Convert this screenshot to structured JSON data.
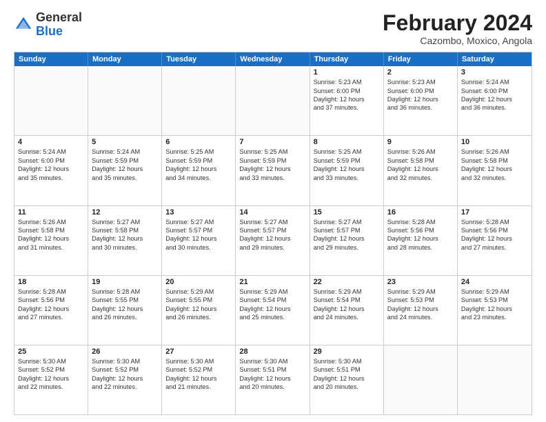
{
  "header": {
    "logo_general": "General",
    "logo_blue": "Blue",
    "title": "February 2024",
    "subtitle": "Cazombo, Moxico, Angola"
  },
  "calendar": {
    "days_of_week": [
      "Sunday",
      "Monday",
      "Tuesday",
      "Wednesday",
      "Thursday",
      "Friday",
      "Saturday"
    ],
    "rows": [
      [
        {
          "day": "",
          "empty": true
        },
        {
          "day": "",
          "empty": true
        },
        {
          "day": "",
          "empty": true
        },
        {
          "day": "",
          "empty": true
        },
        {
          "day": "1",
          "lines": [
            "Sunrise: 5:23 AM",
            "Sunset: 6:00 PM",
            "Daylight: 12 hours",
            "and 37 minutes."
          ]
        },
        {
          "day": "2",
          "lines": [
            "Sunrise: 5:23 AM",
            "Sunset: 6:00 PM",
            "Daylight: 12 hours",
            "and 36 minutes."
          ]
        },
        {
          "day": "3",
          "lines": [
            "Sunrise: 5:24 AM",
            "Sunset: 6:00 PM",
            "Daylight: 12 hours",
            "and 36 minutes."
          ]
        }
      ],
      [
        {
          "day": "4",
          "lines": [
            "Sunrise: 5:24 AM",
            "Sunset: 6:00 PM",
            "Daylight: 12 hours",
            "and 35 minutes."
          ]
        },
        {
          "day": "5",
          "lines": [
            "Sunrise: 5:24 AM",
            "Sunset: 5:59 PM",
            "Daylight: 12 hours",
            "and 35 minutes."
          ]
        },
        {
          "day": "6",
          "lines": [
            "Sunrise: 5:25 AM",
            "Sunset: 5:59 PM",
            "Daylight: 12 hours",
            "and 34 minutes."
          ]
        },
        {
          "day": "7",
          "lines": [
            "Sunrise: 5:25 AM",
            "Sunset: 5:59 PM",
            "Daylight: 12 hours",
            "and 33 minutes."
          ]
        },
        {
          "day": "8",
          "lines": [
            "Sunrise: 5:25 AM",
            "Sunset: 5:59 PM",
            "Daylight: 12 hours",
            "and 33 minutes."
          ]
        },
        {
          "day": "9",
          "lines": [
            "Sunrise: 5:26 AM",
            "Sunset: 5:58 PM",
            "Daylight: 12 hours",
            "and 32 minutes."
          ]
        },
        {
          "day": "10",
          "lines": [
            "Sunrise: 5:26 AM",
            "Sunset: 5:58 PM",
            "Daylight: 12 hours",
            "and 32 minutes."
          ]
        }
      ],
      [
        {
          "day": "11",
          "lines": [
            "Sunrise: 5:26 AM",
            "Sunset: 5:58 PM",
            "Daylight: 12 hours",
            "and 31 minutes."
          ]
        },
        {
          "day": "12",
          "lines": [
            "Sunrise: 5:27 AM",
            "Sunset: 5:58 PM",
            "Daylight: 12 hours",
            "and 30 minutes."
          ]
        },
        {
          "day": "13",
          "lines": [
            "Sunrise: 5:27 AM",
            "Sunset: 5:57 PM",
            "Daylight: 12 hours",
            "and 30 minutes."
          ]
        },
        {
          "day": "14",
          "lines": [
            "Sunrise: 5:27 AM",
            "Sunset: 5:57 PM",
            "Daylight: 12 hours",
            "and 29 minutes."
          ]
        },
        {
          "day": "15",
          "lines": [
            "Sunrise: 5:27 AM",
            "Sunset: 5:57 PM",
            "Daylight: 12 hours",
            "and 29 minutes."
          ]
        },
        {
          "day": "16",
          "lines": [
            "Sunrise: 5:28 AM",
            "Sunset: 5:56 PM",
            "Daylight: 12 hours",
            "and 28 minutes."
          ]
        },
        {
          "day": "17",
          "lines": [
            "Sunrise: 5:28 AM",
            "Sunset: 5:56 PM",
            "Daylight: 12 hours",
            "and 27 minutes."
          ]
        }
      ],
      [
        {
          "day": "18",
          "lines": [
            "Sunrise: 5:28 AM",
            "Sunset: 5:56 PM",
            "Daylight: 12 hours",
            "and 27 minutes."
          ]
        },
        {
          "day": "19",
          "lines": [
            "Sunrise: 5:28 AM",
            "Sunset: 5:55 PM",
            "Daylight: 12 hours",
            "and 26 minutes."
          ]
        },
        {
          "day": "20",
          "lines": [
            "Sunrise: 5:29 AM",
            "Sunset: 5:55 PM",
            "Daylight: 12 hours",
            "and 26 minutes."
          ]
        },
        {
          "day": "21",
          "lines": [
            "Sunrise: 5:29 AM",
            "Sunset: 5:54 PM",
            "Daylight: 12 hours",
            "and 25 minutes."
          ]
        },
        {
          "day": "22",
          "lines": [
            "Sunrise: 5:29 AM",
            "Sunset: 5:54 PM",
            "Daylight: 12 hours",
            "and 24 minutes."
          ]
        },
        {
          "day": "23",
          "lines": [
            "Sunrise: 5:29 AM",
            "Sunset: 5:53 PM",
            "Daylight: 12 hours",
            "and 24 minutes."
          ]
        },
        {
          "day": "24",
          "lines": [
            "Sunrise: 5:29 AM",
            "Sunset: 5:53 PM",
            "Daylight: 12 hours",
            "and 23 minutes."
          ]
        }
      ],
      [
        {
          "day": "25",
          "lines": [
            "Sunrise: 5:30 AM",
            "Sunset: 5:52 PM",
            "Daylight: 12 hours",
            "and 22 minutes."
          ]
        },
        {
          "day": "26",
          "lines": [
            "Sunrise: 5:30 AM",
            "Sunset: 5:52 PM",
            "Daylight: 12 hours",
            "and 22 minutes."
          ]
        },
        {
          "day": "27",
          "lines": [
            "Sunrise: 5:30 AM",
            "Sunset: 5:52 PM",
            "Daylight: 12 hours",
            "and 21 minutes."
          ]
        },
        {
          "day": "28",
          "lines": [
            "Sunrise: 5:30 AM",
            "Sunset: 5:51 PM",
            "Daylight: 12 hours",
            "and 20 minutes."
          ]
        },
        {
          "day": "29",
          "lines": [
            "Sunrise: 5:30 AM",
            "Sunset: 5:51 PM",
            "Daylight: 12 hours",
            "and 20 minutes."
          ]
        },
        {
          "day": "",
          "empty": true
        },
        {
          "day": "",
          "empty": true
        }
      ]
    ]
  }
}
